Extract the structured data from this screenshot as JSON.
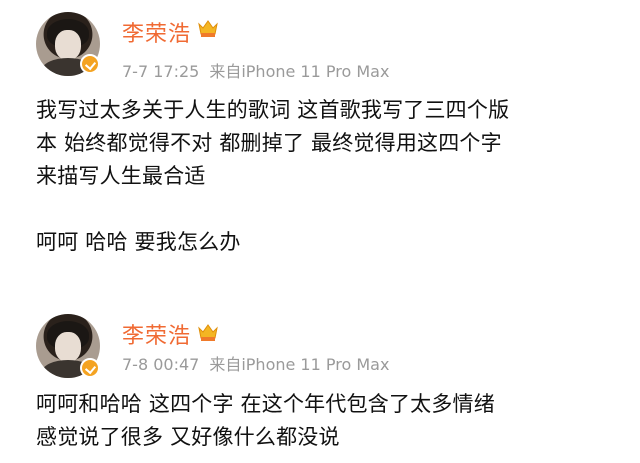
{
  "posts": [
    {
      "author": "李荣浩",
      "time": "7-7 17:25",
      "device": "来自iPhone 11 Pro Max",
      "content_lines": [
        "我写过太多关于人生的歌词 这首歌我写了三四个版",
        "本 始终都觉得不对 都删掉了 最终觉得用这四个字",
        "来描写人生最合适",
        "",
        "呵呵 哈哈 要我怎么办"
      ],
      "icons": [
        "avatar",
        "verified-badge-icon",
        "crown-icon"
      ],
      "colors": {
        "name": "#f06a33",
        "badge": "#f4a322",
        "meta": "#9a9a9a"
      }
    },
    {
      "author": "李荣浩",
      "time": "7-8 00:47",
      "device": "来自iPhone 11 Pro Max",
      "content_lines": [
        "呵呵和哈哈 这四个字 在这个年代包含了太多情绪",
        "感觉说了很多 又好像什么都没说"
      ],
      "icons": [
        "avatar",
        "verified-badge-icon",
        "crown-icon"
      ],
      "colors": {
        "name": "#f06a33",
        "badge": "#f4a322",
        "meta": "#9a9a9a"
      }
    }
  ]
}
